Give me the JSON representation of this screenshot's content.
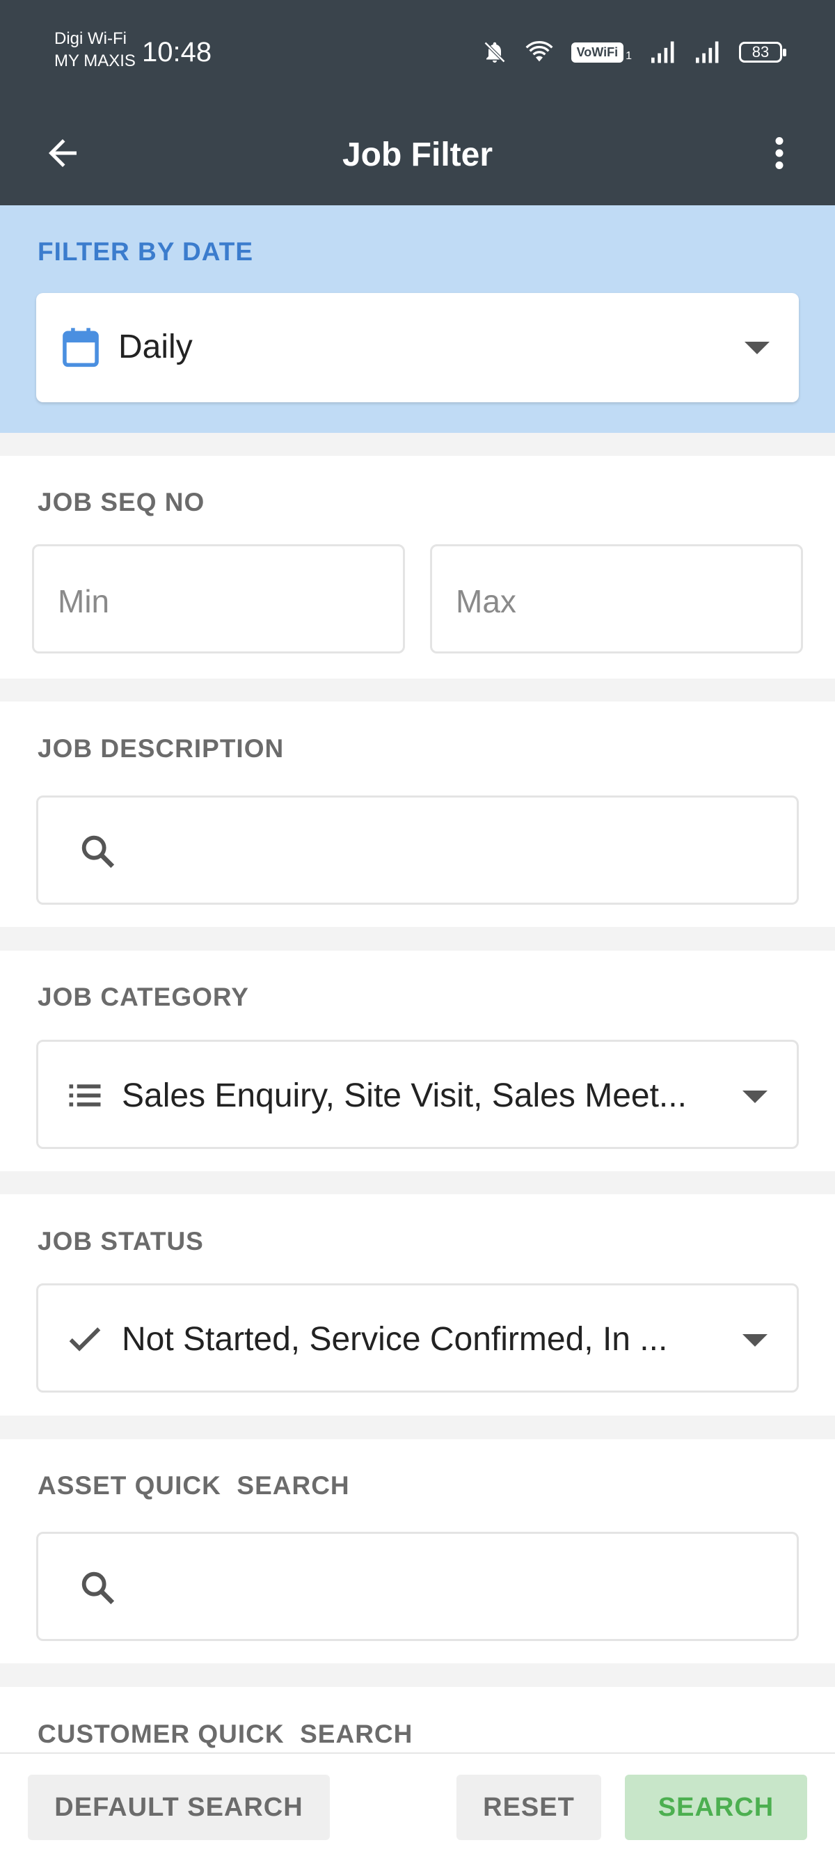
{
  "status_bar": {
    "carrier_line1": "Digi Wi-Fi",
    "carrier_line2": "MY MAXIS",
    "time": "10:48",
    "vowifi": "VoWiFi",
    "vowifi_sub": "1",
    "battery": "83",
    "icons": [
      "bell-off-icon",
      "wifi-icon",
      "vowifi-icon",
      "signal-icon",
      "signal-icon",
      "battery-icon"
    ]
  },
  "appbar": {
    "title": "Job Filter",
    "back_icon": "arrow-left-icon",
    "menu_icon": "more-vert-icon"
  },
  "filter_by_date": {
    "label": "FILTER BY DATE",
    "value": "Daily",
    "icon": "calendar-icon"
  },
  "job_seq_no": {
    "label": "JOB SEQ NO",
    "min_placeholder": "Min",
    "max_placeholder": "Max"
  },
  "job_description": {
    "label": "JOB DESCRIPTION",
    "icon": "search-icon"
  },
  "job_category": {
    "label": "JOB CATEGORY",
    "value": "Sales Enquiry, Site Visit, Sales Meet...",
    "icon": "list-icon"
  },
  "job_status": {
    "label": "JOB STATUS",
    "value": "Not Started, Service Confirmed, In ...",
    "icon": "check-icon"
  },
  "asset_quick_search": {
    "label": "ASSET QUICK  SEARCH",
    "icon": "search-icon"
  },
  "customer_quick_search": {
    "label": "CUSTOMER QUICK  SEARCH"
  },
  "actions": {
    "default_search": "DEFAULT SEARCH",
    "reset": "RESET",
    "search": "SEARCH"
  },
  "colors": {
    "appbar": "#3a444c",
    "date_section_bg": "#c0dbf5",
    "date_label": "#3b7ccd",
    "search_button_bg": "#c8e6c9",
    "search_button_text": "#4caf50"
  }
}
